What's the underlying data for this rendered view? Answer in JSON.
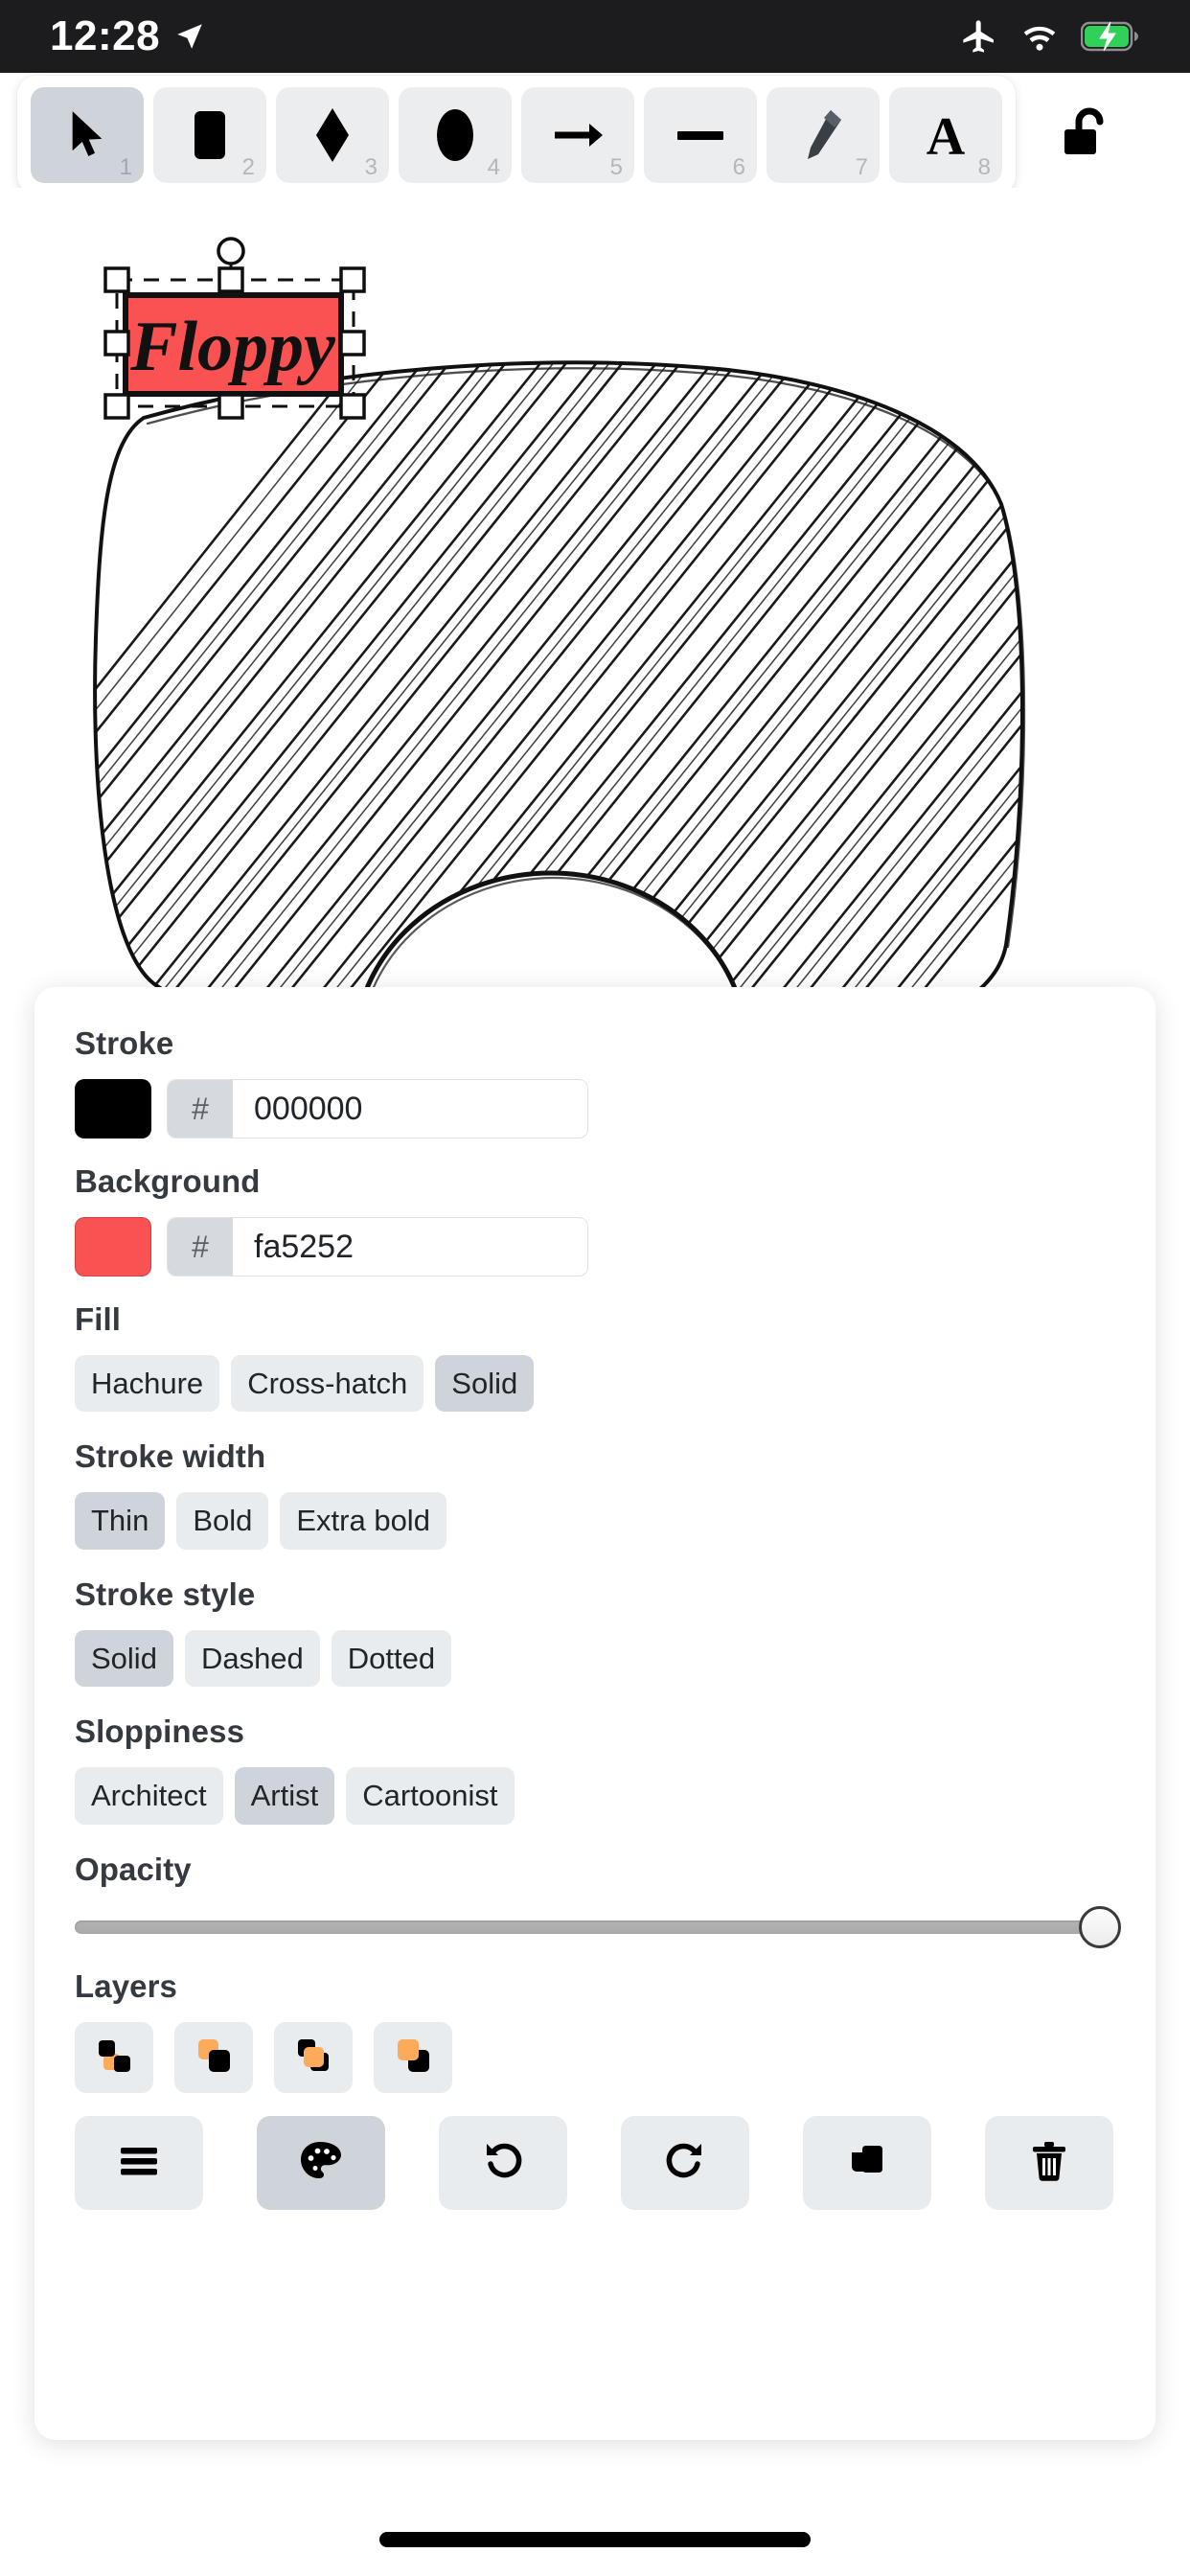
{
  "statusbar": {
    "time": "12:28",
    "icons": [
      "location-arrow-icon",
      "airplane-mode-icon",
      "wifi-icon",
      "battery-charging-icon"
    ],
    "background": "#1c1c1e"
  },
  "toolbar": {
    "tools": [
      {
        "name": "selection-tool",
        "icon": "cursor-arrow-icon",
        "shortcut": "1",
        "selected": true
      },
      {
        "name": "rectangle-tool",
        "icon": "rectangle-icon",
        "shortcut": "2",
        "selected": false
      },
      {
        "name": "diamond-tool",
        "icon": "diamond-icon",
        "shortcut": "3",
        "selected": false
      },
      {
        "name": "ellipse-tool",
        "icon": "ellipse-icon",
        "shortcut": "4",
        "selected": false
      },
      {
        "name": "arrow-tool",
        "icon": "arrow-right-icon",
        "shortcut": "5",
        "selected": false
      },
      {
        "name": "line-tool",
        "icon": "line-icon",
        "shortcut": "6",
        "selected": false
      },
      {
        "name": "draw-tool",
        "icon": "pencil-icon",
        "shortcut": "7",
        "selected": false
      },
      {
        "name": "text-tool",
        "icon": "letter-a-icon",
        "shortcut": "8",
        "selected": false
      }
    ],
    "lock": {
      "name": "keep-tool-active-lock",
      "icon": "unlocked-padlock-icon",
      "locked": false
    }
  },
  "canvas": {
    "shape_label": "Floppy",
    "shape_fill": "#fa5252",
    "shape_stroke": "#000000",
    "background_shape": "hachure-filled-floppy-disk",
    "selection_handles": 8,
    "rotation_handle": true
  },
  "panel": {
    "stroke": {
      "label": "Stroke",
      "swatch_color": "#000000",
      "hash": "#",
      "hex": "000000",
      "placeholder": "000000"
    },
    "background": {
      "label": "Background",
      "swatch_color": "#fa5252",
      "hash": "#",
      "hex": "fa5252",
      "placeholder": "fa5252"
    },
    "fill": {
      "label": "Fill",
      "options": [
        "Hachure",
        "Cross-hatch",
        "Solid"
      ],
      "selected": "Solid"
    },
    "stroke_width": {
      "label": "Stroke width",
      "options": [
        "Thin",
        "Bold",
        "Extra bold"
      ],
      "selected": "Thin"
    },
    "stroke_style": {
      "label": "Stroke style",
      "options": [
        "Solid",
        "Dashed",
        "Dotted"
      ],
      "selected": "Solid"
    },
    "sloppiness": {
      "label": "Sloppiness",
      "options": [
        "Architect",
        "Artist",
        "Cartoonist"
      ],
      "selected": "Artist"
    },
    "opacity": {
      "label": "Opacity",
      "value": 100,
      "min": 0,
      "max": 100
    },
    "layers": {
      "label": "Layers",
      "buttons": [
        {
          "name": "send-to-back-button",
          "icon": "send-to-back-icon"
        },
        {
          "name": "send-backward-button",
          "icon": "send-backward-icon"
        },
        {
          "name": "bring-forward-button",
          "icon": "bring-forward-icon"
        },
        {
          "name": "bring-to-front-button",
          "icon": "bring-to-front-icon"
        }
      ],
      "accent_color": "#fdab5a"
    },
    "actions": [
      {
        "name": "menu-button",
        "icon": "hamburger-menu-icon",
        "selected": false
      },
      {
        "name": "palette-button",
        "icon": "palette-icon",
        "selected": true
      },
      {
        "name": "undo-button",
        "icon": "undo-arrow-icon",
        "selected": false
      },
      {
        "name": "redo-button",
        "icon": "redo-arrow-icon",
        "selected": false
      },
      {
        "name": "duplicate-button",
        "icon": "duplicate-copy-icon",
        "selected": false
      },
      {
        "name": "delete-button",
        "icon": "trash-icon",
        "selected": false
      }
    ]
  }
}
